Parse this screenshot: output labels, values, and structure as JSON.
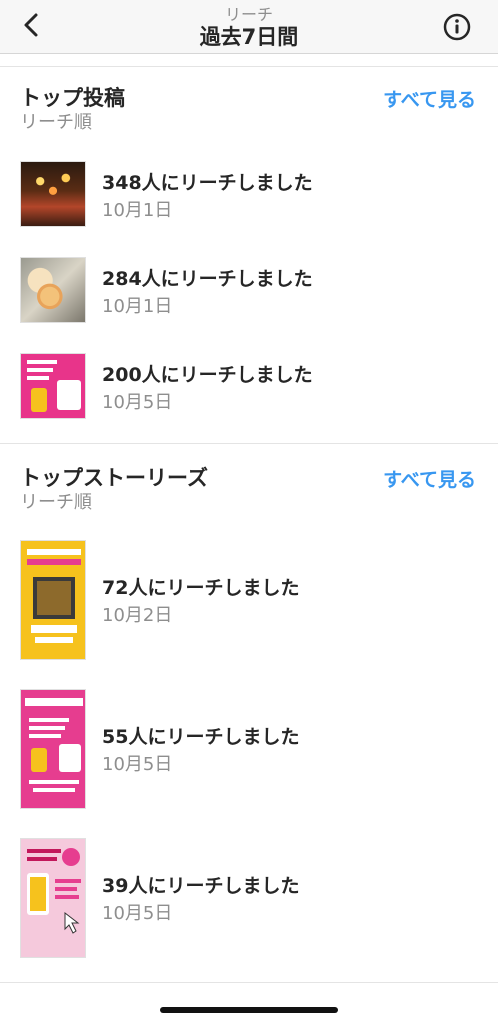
{
  "header": {
    "subtitle": "リーチ",
    "title": "過去7日間"
  },
  "top_posts": {
    "title": "トップ投稿",
    "subtitle": "リーチ順",
    "see_all": "すべて見る",
    "items": [
      {
        "reach": "348人にリーチしました",
        "date": "10月1日"
      },
      {
        "reach": "284人にリーチしました",
        "date": "10月1日"
      },
      {
        "reach": "200人にリーチしました",
        "date": "10月5日"
      }
    ]
  },
  "top_stories": {
    "title": "トップストーリーズ",
    "subtitle": "リーチ順",
    "see_all": "すべて見る",
    "items": [
      {
        "reach": "72人にリーチしました",
        "date": "10月2日"
      },
      {
        "reach": "55人にリーチしました",
        "date": "10月5日"
      },
      {
        "reach": "39人にリーチしました",
        "date": "10月5日"
      }
    ]
  },
  "colors": {
    "accent": "#3897f0",
    "secondary_text": "#8e8e8e",
    "primary_text": "#262626"
  },
  "icons": {
    "back": "chevron-left-icon",
    "info": "info-icon"
  }
}
